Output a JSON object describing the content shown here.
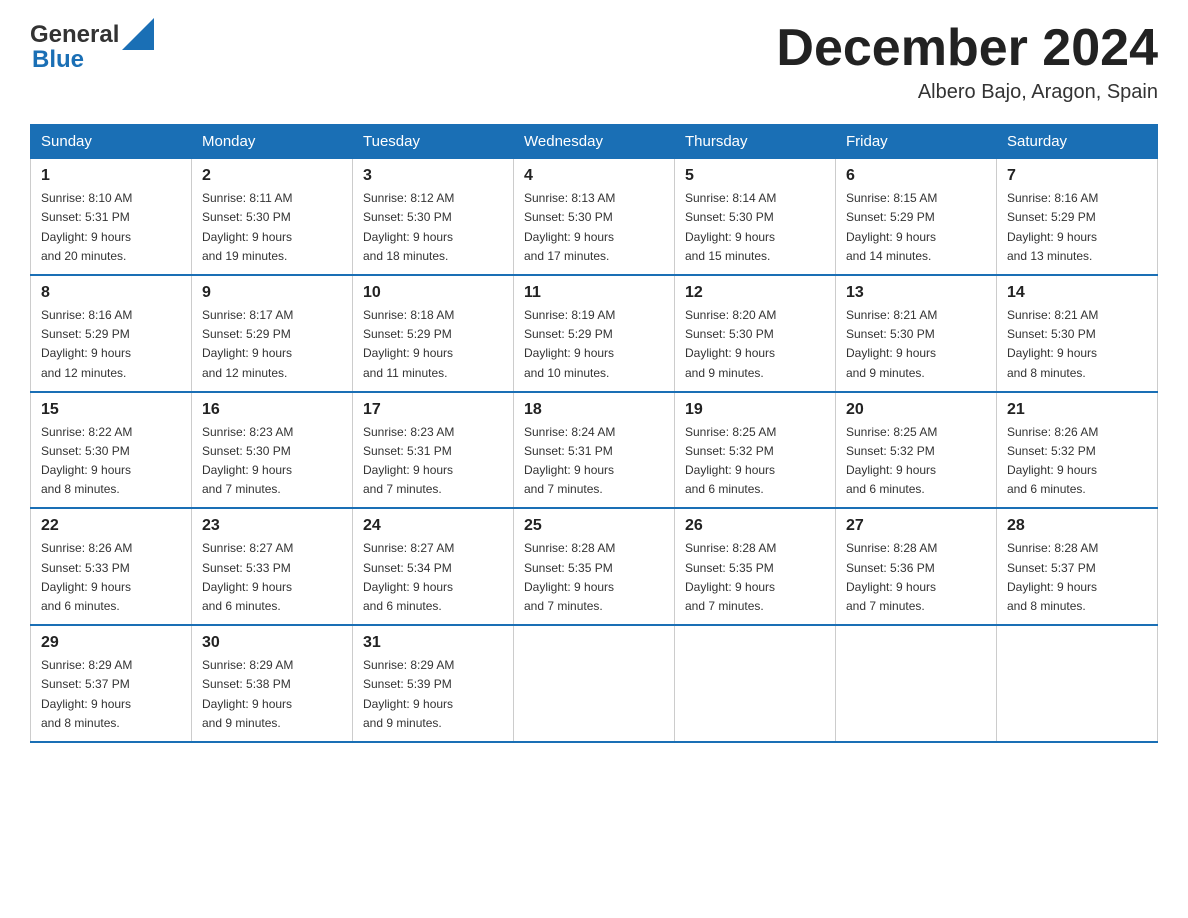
{
  "header": {
    "logo": {
      "general": "General",
      "blue": "Blue"
    },
    "title": "December 2024",
    "location": "Albero Bajo, Aragon, Spain"
  },
  "calendar": {
    "days_of_week": [
      "Sunday",
      "Monday",
      "Tuesday",
      "Wednesday",
      "Thursday",
      "Friday",
      "Saturday"
    ],
    "weeks": [
      [
        {
          "day": "1",
          "sunrise": "8:10 AM",
          "sunset": "5:31 PM",
          "daylight": "9 hours and 20 minutes."
        },
        {
          "day": "2",
          "sunrise": "8:11 AM",
          "sunset": "5:30 PM",
          "daylight": "9 hours and 19 minutes."
        },
        {
          "day": "3",
          "sunrise": "8:12 AM",
          "sunset": "5:30 PM",
          "daylight": "9 hours and 18 minutes."
        },
        {
          "day": "4",
          "sunrise": "8:13 AM",
          "sunset": "5:30 PM",
          "daylight": "9 hours and 17 minutes."
        },
        {
          "day": "5",
          "sunrise": "8:14 AM",
          "sunset": "5:30 PM",
          "daylight": "9 hours and 15 minutes."
        },
        {
          "day": "6",
          "sunrise": "8:15 AM",
          "sunset": "5:29 PM",
          "daylight": "9 hours and 14 minutes."
        },
        {
          "day": "7",
          "sunrise": "8:16 AM",
          "sunset": "5:29 PM",
          "daylight": "9 hours and 13 minutes."
        }
      ],
      [
        {
          "day": "8",
          "sunrise": "8:16 AM",
          "sunset": "5:29 PM",
          "daylight": "9 hours and 12 minutes."
        },
        {
          "day": "9",
          "sunrise": "8:17 AM",
          "sunset": "5:29 PM",
          "daylight": "9 hours and 12 minutes."
        },
        {
          "day": "10",
          "sunrise": "8:18 AM",
          "sunset": "5:29 PM",
          "daylight": "9 hours and 11 minutes."
        },
        {
          "day": "11",
          "sunrise": "8:19 AM",
          "sunset": "5:29 PM",
          "daylight": "9 hours and 10 minutes."
        },
        {
          "day": "12",
          "sunrise": "8:20 AM",
          "sunset": "5:30 PM",
          "daylight": "9 hours and 9 minutes."
        },
        {
          "day": "13",
          "sunrise": "8:21 AM",
          "sunset": "5:30 PM",
          "daylight": "9 hours and 9 minutes."
        },
        {
          "day": "14",
          "sunrise": "8:21 AM",
          "sunset": "5:30 PM",
          "daylight": "9 hours and 8 minutes."
        }
      ],
      [
        {
          "day": "15",
          "sunrise": "8:22 AM",
          "sunset": "5:30 PM",
          "daylight": "9 hours and 8 minutes."
        },
        {
          "day": "16",
          "sunrise": "8:23 AM",
          "sunset": "5:30 PM",
          "daylight": "9 hours and 7 minutes."
        },
        {
          "day": "17",
          "sunrise": "8:23 AM",
          "sunset": "5:31 PM",
          "daylight": "9 hours and 7 minutes."
        },
        {
          "day": "18",
          "sunrise": "8:24 AM",
          "sunset": "5:31 PM",
          "daylight": "9 hours and 7 minutes."
        },
        {
          "day": "19",
          "sunrise": "8:25 AM",
          "sunset": "5:32 PM",
          "daylight": "9 hours and 6 minutes."
        },
        {
          "day": "20",
          "sunrise": "8:25 AM",
          "sunset": "5:32 PM",
          "daylight": "9 hours and 6 minutes."
        },
        {
          "day": "21",
          "sunrise": "8:26 AM",
          "sunset": "5:32 PM",
          "daylight": "9 hours and 6 minutes."
        }
      ],
      [
        {
          "day": "22",
          "sunrise": "8:26 AM",
          "sunset": "5:33 PM",
          "daylight": "9 hours and 6 minutes."
        },
        {
          "day": "23",
          "sunrise": "8:27 AM",
          "sunset": "5:33 PM",
          "daylight": "9 hours and 6 minutes."
        },
        {
          "day": "24",
          "sunrise": "8:27 AM",
          "sunset": "5:34 PM",
          "daylight": "9 hours and 6 minutes."
        },
        {
          "day": "25",
          "sunrise": "8:28 AM",
          "sunset": "5:35 PM",
          "daylight": "9 hours and 7 minutes."
        },
        {
          "day": "26",
          "sunrise": "8:28 AM",
          "sunset": "5:35 PM",
          "daylight": "9 hours and 7 minutes."
        },
        {
          "day": "27",
          "sunrise": "8:28 AM",
          "sunset": "5:36 PM",
          "daylight": "9 hours and 7 minutes."
        },
        {
          "day": "28",
          "sunrise": "8:28 AM",
          "sunset": "5:37 PM",
          "daylight": "9 hours and 8 minutes."
        }
      ],
      [
        {
          "day": "29",
          "sunrise": "8:29 AM",
          "sunset": "5:37 PM",
          "daylight": "9 hours and 8 minutes."
        },
        {
          "day": "30",
          "sunrise": "8:29 AM",
          "sunset": "5:38 PM",
          "daylight": "9 hours and 9 minutes."
        },
        {
          "day": "31",
          "sunrise": "8:29 AM",
          "sunset": "5:39 PM",
          "daylight": "9 hours and 9 minutes."
        },
        null,
        null,
        null,
        null
      ]
    ],
    "labels": {
      "sunrise": "Sunrise:",
      "sunset": "Sunset:",
      "daylight": "Daylight:"
    }
  }
}
